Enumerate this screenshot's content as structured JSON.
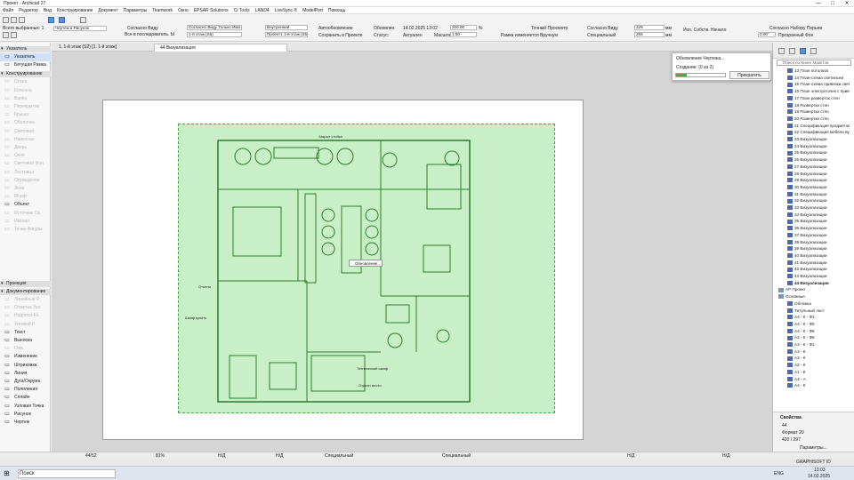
{
  "window": {
    "title": "Проект - Archicad 27",
    "controls": [
      "—",
      "□",
      "✕"
    ]
  },
  "menu": [
    "Файл",
    "Редактор",
    "Вид",
    "Конструирование",
    "Документ",
    "Параметры",
    "Teamwork",
    "Окно",
    "EPSAR Solutions",
    "CI Tools",
    "LAND4",
    "LiveSync ®",
    "ModelPort",
    "Помощь"
  ],
  "toolbar": {
    "selected": "Всего выбранных: 1",
    "layers": "Чертеж в Рисунок",
    "all_following": "Все в последователь. Ы",
    "view_label": "Согласно Виду Только Имя",
    "floor": "1-й этаж (S5)",
    "floor_label": "Согласно Виду",
    "internal": "Внутренний",
    "project": "Проект1.1-й этаж (S5)",
    "auto_update": "Автообновление",
    "save_in_project": "Сохранить в Проекте",
    "updated_label": "Обновлен:",
    "updated_value": "14.02.2025 13:02",
    "status_label": "Статус:",
    "status_value": "Актуален",
    "zoom_value": "200.00",
    "zoom_unit": "%",
    "scale_label": "Масшта",
    "scale_value": "1:50",
    "exact_view": "Точный Просмотр",
    "frame_changes": "Рамка изменяется Вручную",
    "view_setting": "Согласно Виду",
    "special": "Специальный",
    "width_value": "329",
    "height_value": "255",
    "unit": "мм",
    "own_origin": "Исп. Собств. Начало",
    "pen_set": "Согласно Набору Перьев",
    "angle": "0.00°",
    "transparent_bg": "Прозрачный Фон"
  },
  "tabs": [
    {
      "label": "1. 1-й этаж (S2) [1. 1-й этаж]",
      "active": false
    },
    {
      "label": "44 Визуализация",
      "active": true
    }
  ],
  "left_panel": {
    "sec_select": "Указатель",
    "items_top": [
      {
        "label": "Указатель",
        "icon": "arrow",
        "sel": true
      },
      {
        "label": "Бегущая Рамка",
        "icon": "marquee",
        "sel": false
      }
    ],
    "sec_design": "Конструирование",
    "design": [
      "Стена",
      "Колонна",
      "Балка",
      "Перекрытие",
      "Крыша",
      "Оболочка",
      "Световой",
      "Навесная",
      "Дверь",
      "Окно",
      "Световой Фон",
      "Лестница",
      "Ограждение",
      "Зона",
      "Морф",
      "Объект",
      "Источник Св.",
      "Импорт",
      "Точка Фигуры"
    ],
    "design_dis": [
      true,
      true,
      true,
      true,
      true,
      true,
      true,
      true,
      true,
      true,
      true,
      true,
      true,
      true,
      true,
      false,
      true,
      true,
      true
    ],
    "sec_proj": "Проекция",
    "sec_doc": "Документирование",
    "doc": [
      "Линейный Р.",
      "Отметка Уро",
      "Надписи-Ко.",
      "Угловой Р.",
      "Текст",
      "Выноска",
      "Отм.",
      "Изменение",
      "Штриховка",
      "Линия",
      "Дуга/Окружн.",
      "Полилиния",
      "Сплайн",
      "Узловая Точка",
      "Рисунок",
      "Чертеж"
    ],
    "doc_dis": [
      true,
      true,
      true,
      true,
      false,
      false,
      true,
      false,
      false,
      false,
      false,
      false,
      false,
      false,
      false,
      false
    ]
  },
  "popup": {
    "title": "Обновление Чертежа...",
    "creating": "Создание: (0 из 2)",
    "progress": 0.22,
    "stop": "Прекратить"
  },
  "tooltip": "Обновление...",
  "annotations": [
    "Закрыт стойка",
    "Отопли",
    "Шкаф купить",
    "Технический шкаф",
    "Отдохн место"
  ],
  "tree_search": "Поиск по Книге Макетов",
  "tree": [
    {
      "t": "13 План потолков",
      "k": "doc"
    },
    {
      "t": "14 План-схема светильни",
      "k": "doc"
    },
    {
      "t": "15 План-схема привязки свет",
      "k": "doc"
    },
    {
      "t": "16 План электроточек с прив",
      "k": "doc"
    },
    {
      "t": "17 План разверток стен",
      "k": "doc"
    },
    {
      "t": "18 Развертки стен",
      "k": "doc"
    },
    {
      "t": "19 Развертки стен",
      "k": "doc"
    },
    {
      "t": "20 Развертки стен",
      "k": "doc"
    },
    {
      "t": "21 Спецификация предметов",
      "k": "doc"
    },
    {
      "t": "22 Спецификация мебели ву",
      "k": "doc"
    },
    {
      "t": "23 Визуализации",
      "k": "doc"
    },
    {
      "t": "24 Визуализации",
      "k": "doc"
    },
    {
      "t": "25 Визуализации",
      "k": "doc"
    },
    {
      "t": "26 Визуализации",
      "k": "doc"
    },
    {
      "t": "27 Визуализации",
      "k": "doc"
    },
    {
      "t": "28 Визуализации",
      "k": "doc"
    },
    {
      "t": "29 Визуализации",
      "k": "doc"
    },
    {
      "t": "30 Визуализации",
      "k": "doc"
    },
    {
      "t": "31 Визуализации",
      "k": "doc"
    },
    {
      "t": "32 Визуализации",
      "k": "doc"
    },
    {
      "t": "33 Визуализации",
      "k": "doc"
    },
    {
      "t": "34 Визуализации",
      "k": "doc"
    },
    {
      "t": "35 Визуализации",
      "k": "doc"
    },
    {
      "t": "36 Визуализации",
      "k": "doc"
    },
    {
      "t": "37 Визуализации",
      "k": "doc"
    },
    {
      "t": "38 Визуализации",
      "k": "doc"
    },
    {
      "t": "39 Визуализации",
      "k": "doc"
    },
    {
      "t": "40 Визуализации",
      "k": "doc"
    },
    {
      "t": "41 Визуализации",
      "k": "doc"
    },
    {
      "t": "42 Визуализации",
      "k": "doc"
    },
    {
      "t": "43 Визуализации",
      "k": "doc"
    },
    {
      "t": "44 Визуализации",
      "k": "bold"
    },
    {
      "t": "АР Проект",
      "k": "fold"
    },
    {
      "t": "Основные",
      "k": "fold"
    },
    {
      "t": "Обложка",
      "k": "doc"
    },
    {
      "t": "Титульный лист",
      "k": "doc"
    },
    {
      "t": "А4 - К - Ф1",
      "k": "doc"
    },
    {
      "t": "А4 - К - Ф5",
      "k": "doc"
    },
    {
      "t": "А4 - К - Ф6",
      "k": "doc"
    },
    {
      "t": "А4 - К - Ф8",
      "k": "doc"
    },
    {
      "t": "А3 - К - Ф1",
      "k": "doc"
    },
    {
      "t": "А3 - К",
      "k": "doc"
    },
    {
      "t": "А3 - К",
      "k": "doc"
    },
    {
      "t": "А2 - К",
      "k": "doc"
    },
    {
      "t": "А1 - К",
      "k": "doc"
    },
    {
      "t": "А4 - А",
      "k": "doc"
    },
    {
      "t": "А4 - К",
      "k": "doc"
    }
  ],
  "props": {
    "title": "Свойства",
    "id": "44",
    "format": "Формат 20",
    "size": "420 / 297",
    "params": "Параметры..."
  },
  "status": {
    "page": "44/52",
    "zoom": "81%",
    "nd": "Н/Д",
    "spec1": "Специальный",
    "spec2": "Специальный",
    "brand": "GRAPHISOFT ID"
  },
  "taskbar": {
    "search": "Поиск",
    "lang": "ENG",
    "time": "13:03",
    "date": "14.02.2025"
  }
}
